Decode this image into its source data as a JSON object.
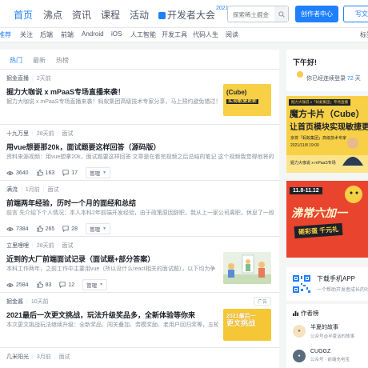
{
  "header": {
    "nav": [
      "首页",
      "沸点",
      "资讯",
      "课程",
      "活动"
    ],
    "brand_label": "开发者大会",
    "brand_badge": "2021",
    "search_placeholder": "探索稀土掘金",
    "creator_button": "创作者中心",
    "write_button": "写文"
  },
  "categories": [
    "推荐",
    "关注",
    "后端",
    "前端",
    "Android",
    "iOS",
    "人工智能",
    "开发工具",
    "代码人生",
    "阅读",
    "标签"
  ],
  "feed_tabs": [
    "热门",
    "最新",
    "热榜"
  ],
  "articles": [
    {
      "author": "掘金直播",
      "time": "2天前",
      "tag": "",
      "title": "掘力大咖说 x mPaaS专场直播来袭！",
      "abstract": "掘力大咖说 x mPaaS专场直播来袭！蚂蚁集团高级技术专家分享，马上预约避免错过！",
      "thumb_text": "(Cube)\n实现敏捷更新",
      "stats": null
    },
    {
      "author": "十九万里",
      "time": "28天前",
      "tag": "面试",
      "title": "用vue想要那20k，面试题要这样回答（源码版）",
      "abstract": "资料来源视频：用vue想拿20k，面试题要这样回答 文章是在看完视频之后总结的笔记 这个视频我觉得他将的都是",
      "stats": {
        "views": "3640",
        "likes": "163",
        "comments": "17",
        "manage": "管理"
      }
    },
    {
      "author": "满流",
      "time": "1月前",
      "tag": "面试",
      "title": "前端两年经验，历时一个月的面经和总结",
      "abstract": "前言 先介绍下个人情况：本人本科2年前端开发经验，由于政策原因辞职，我从上一家公司离职，休息了一段",
      "stats": {
        "views": "7384",
        "likes": "265",
        "comments": "28",
        "manage": "管理"
      }
    },
    {
      "author": "立里哩哩",
      "time": "28天前",
      "tag": "面试",
      "title": "近到的大厂前端面试记录（面试题+部分答案）",
      "abstract": "本科工作两年，之前工作中主要用vue（所以没什么react相关的面试题），以下均为争",
      "stats": {
        "views": "2584",
        "likes": "83",
        "comments": "12",
        "manage": "管理"
      }
    },
    {
      "author": "掘金酱",
      "time": "10天前",
      "tag": "",
      "title": "2021最后一次更文挑战，玩法升级奖品多，全新体验等你来",
      "abstract": "本次更文挑战玩法继续升级：全新奖品、闯关叠加、劳模奖励、老用户回归奖等，五轮率",
      "ad_label": "广告",
      "thumb_text": "2021最后一\n更文挑战",
      "stats": null
    },
    {
      "author": "几米阳光",
      "time": "3月前",
      "tag": "面试",
      "title": "",
      "abstract": "",
      "stats": null
    }
  ],
  "sidebar": {
    "greeting": "下午好!",
    "greeting_sub_prefix": "你已经连续登录",
    "greeting_days": "72",
    "greeting_sub_suffix": "天",
    "banner1": {
      "kicker": "掘力大咖说 x「蚂蚁集团」专场直播",
      "title": "魔方卡片（Cube）",
      "subtitle": "让首页模块实现敏捷更新",
      "speaker": "京将「蚂蚁集团」高级技术专家",
      "date": "2021/11/8 19:00",
      "footer": "掘力大咖说 x mPaaS专场"
    },
    "banner2": {
      "dates": "11.8-11.12",
      "title": "沸常六加一",
      "slogan": "砸彩蛋 千元礼"
    },
    "app": {
      "title": "下载手机APP",
      "subtitle": "一个帮助开发者成长的社区"
    },
    "authors_title": "作者榜",
    "authors": [
      {
        "name": "半夏的故事",
        "desc": "公众号@半夏话的故事"
      },
      {
        "name": "CUGGZ",
        "desc": "公众号 · 前端充电宝"
      }
    ]
  },
  "colors": {
    "accent": "#1e80ff",
    "banner_yellow": "#f7d046",
    "banner_red": "#e8442e"
  }
}
